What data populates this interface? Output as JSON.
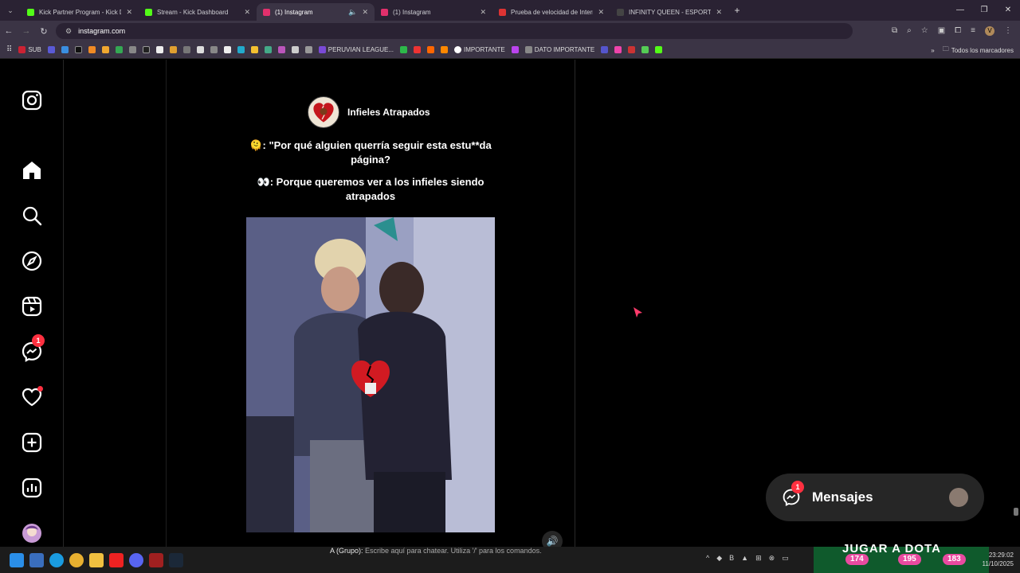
{
  "browser": {
    "tabs": [
      {
        "title": "Kick Partner Program - Kick Dashboard",
        "color": "#53fc18",
        "active": false
      },
      {
        "title": "Stream - Kick Dashboard",
        "color": "#53fc18",
        "active": false
      },
      {
        "title": "(1) Instagram",
        "color": "#e1306c",
        "active": true
      },
      {
        "title": "(1) Instagram",
        "color": "#e1306c",
        "active": false
      },
      {
        "title": "Prueba de velocidad de Internet",
        "color": "#d33",
        "active": false
      },
      {
        "title": "INFINITY QUEEN - ESPORTS FEMENINO",
        "color": "#444",
        "active": false
      }
    ],
    "url": "instagram.com",
    "bookmarks": [
      "SUB",
      "PERUVIAN LEAGUE...",
      "IMPORTANTE",
      "DATO IMPORTANTE"
    ],
    "all_bookmarks": "Todos los marcadores",
    "profile_initial": "V"
  },
  "post": {
    "account": "Infieles Atrapados",
    "caption_1": "🫠: \"Por qué alguien querría seguir esta estu**da página?",
    "caption_2": "👀: Porque queremos ver a los infieles siendo atrapados"
  },
  "sidebar": {
    "messages_badge": "1"
  },
  "messages": {
    "label": "Mensajes",
    "badge": "1"
  },
  "taskbar": {
    "chat_prefix": "A (Grupo):",
    "chat_placeholder": "Escribe aquí para chatear. Utiliza '/' para los comandos.",
    "banner": "JUGAR A DOTA",
    "stat_1": "174",
    "stat_2": "195",
    "stat_3": "183",
    "time": "23:29:02",
    "date": "11/10/2025"
  }
}
